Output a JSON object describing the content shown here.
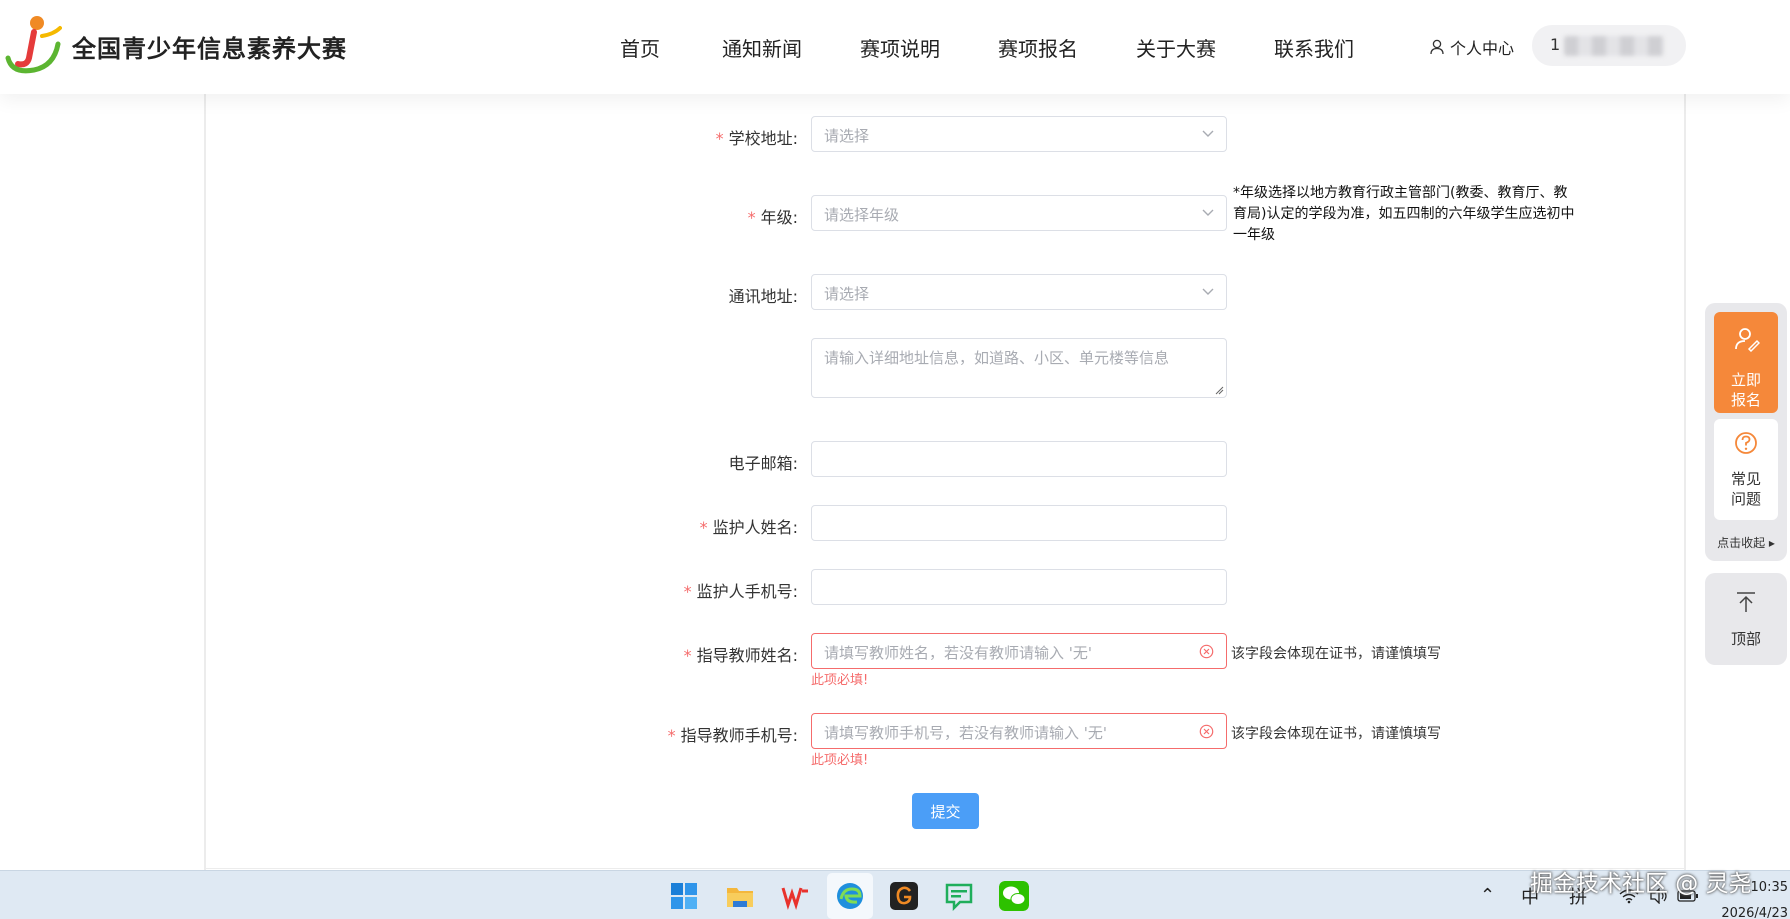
{
  "header": {
    "site_title": "全国青少年信息素养大赛",
    "nav": [
      "首页",
      "通知新闻",
      "赛项说明",
      "赛项报名",
      "关于大赛",
      "联系我们"
    ],
    "user_center": "个人中心",
    "account_prefix": "1"
  },
  "form": {
    "school_address": {
      "label": "学校地址:",
      "placeholder": "请选择"
    },
    "grade": {
      "label": "年级:",
      "placeholder": "请选择年级",
      "note": "*年级选择以地方教育行政主管部门(教委、教育厅、教育局)认定的学段为准，如五四制的六年级学生应选初中一年级"
    },
    "mail_address": {
      "label": "通讯地址:",
      "placeholder": "请选择",
      "detail_placeholder": "请输入详细地址信息，如道路、小区、单元楼等信息"
    },
    "email": {
      "label": "电子邮箱:"
    },
    "guardian_name": {
      "label": "监护人姓名:"
    },
    "guardian_phone": {
      "label": "监护人手机号:"
    },
    "teacher_name": {
      "label": "指导教师姓名:",
      "placeholder": "请填写教师姓名，若没有教师请输入 '无'",
      "hint": "该字段会体现在证书，请谨慎填写",
      "error": "此项必填!"
    },
    "teacher_phone": {
      "label": "指导教师手机号:",
      "placeholder": "请填写教师手机号，若没有教师请输入 '无'",
      "hint": "该字段会体现在证书，请谨慎填写",
      "error": "此项必填!"
    },
    "required_mark": "*",
    "submit": "提交"
  },
  "side": {
    "signup": [
      "立即",
      "报名"
    ],
    "faq": [
      "常见",
      "问题"
    ],
    "collapse": "点击收起",
    "top": "顶部"
  },
  "taskbar": {
    "tray": {
      "ime1": "中",
      "ime2": "拼"
    },
    "time": "10:35",
    "date": "2026/4/23"
  },
  "watermark": "掘金技术社区 @ 灵尧"
}
